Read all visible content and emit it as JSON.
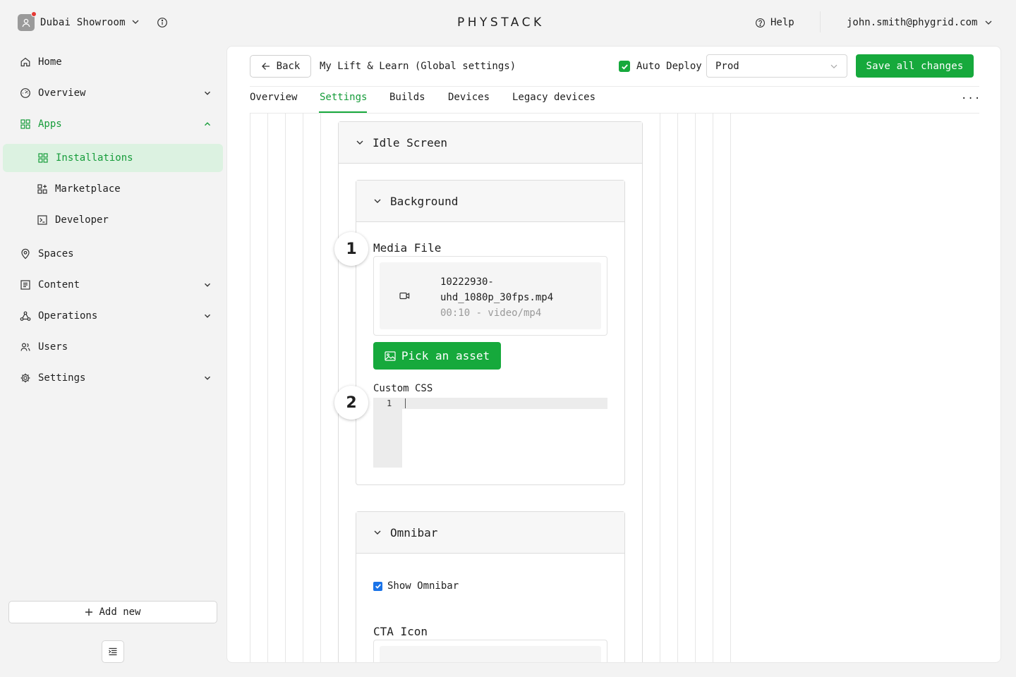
{
  "workspace": {
    "name": "Dubai Showroom"
  },
  "brand": {
    "logo_text": "PHYSTACK",
    "accent": "#16a93c"
  },
  "header": {
    "help_label": "Help",
    "user_email": "john.smith@phygrid.com"
  },
  "sidebar": {
    "items": [
      {
        "label": "Home",
        "icon": "home-icon"
      },
      {
        "label": "Overview",
        "icon": "gauge-icon"
      },
      {
        "label": "Apps",
        "icon": "grid-icon"
      },
      {
        "label": "Installations",
        "icon": "grid-icon"
      },
      {
        "label": "Marketplace",
        "icon": "grid-plus-icon"
      },
      {
        "label": "Developer",
        "icon": "terminal-icon"
      },
      {
        "label": "Spaces",
        "icon": "map-pin-icon"
      },
      {
        "label": "Content",
        "icon": "document-icon"
      },
      {
        "label": "Operations",
        "icon": "network-icon"
      },
      {
        "label": "Users",
        "icon": "users-icon"
      },
      {
        "label": "Settings",
        "icon": "gear-icon"
      }
    ],
    "add_new_label": "Add new"
  },
  "page": {
    "back_label": "Back",
    "title": "My Lift & Learn (Global settings)",
    "auto_deploy_label": "Auto Deploy",
    "auto_deploy_checked": true,
    "environment": "Prod",
    "save_label": "Save all changes",
    "tabs": [
      "Overview",
      "Settings",
      "Builds",
      "Devices",
      "Legacy devices"
    ],
    "active_tab": "Settings",
    "more_label": "..."
  },
  "settings": {
    "idle_screen": {
      "title": "Idle Screen"
    },
    "background": {
      "title": "Background",
      "media_file_label": "Media File",
      "file": {
        "name_line1": "10222930-",
        "name_line2": "uhd_1080p_30fps.mp4",
        "meta": "00:10 - video/mp4"
      },
      "pick_asset_label": "Pick an asset",
      "custom_css_label": "Custom CSS",
      "code_line_number": "1"
    },
    "omnibar": {
      "title": "Omnibar",
      "show_omnibar_label": "Show Omnibar",
      "show_omnibar_checked": true,
      "cta_icon_label": "CTA Icon"
    },
    "badges": [
      "1",
      "2"
    ]
  }
}
